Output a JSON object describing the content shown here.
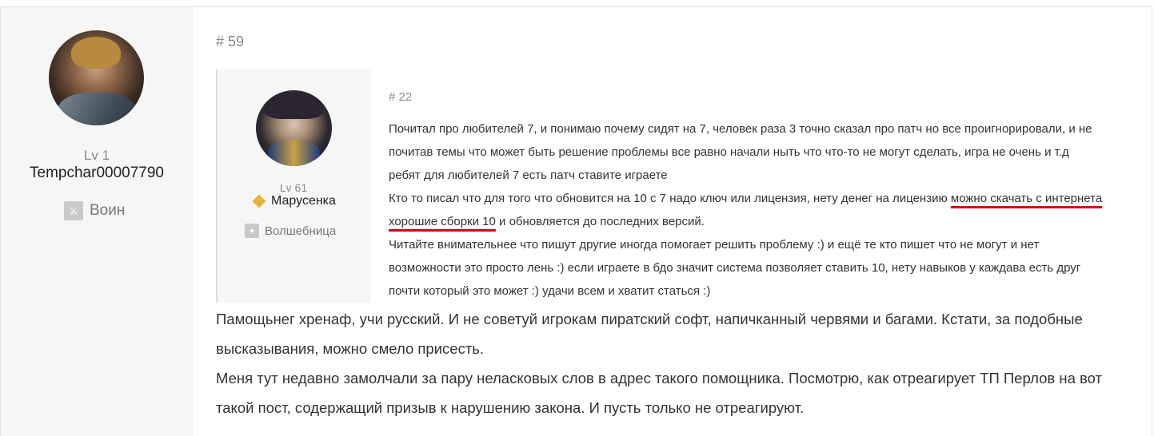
{
  "post": {
    "number": "# 59",
    "author": {
      "level": "Lv 1",
      "name": "Tempchar00007790",
      "class_name": "Воин",
      "class_icon": "warrior-class-icon"
    },
    "quote": {
      "number": "# 22",
      "author": {
        "level": "Lv 61",
        "name": "Марусенка",
        "badge_icon": "diamond-icon",
        "badge_color": "#e8b13a",
        "class_name": "Волшебница",
        "class_icon": "sorceress-class-icon"
      },
      "lines": {
        "p1_l1": "Почитал про любителей 7, и понимаю почему сидят на 7, человек раза 3 точно сказал про патч но все проигнорировали, и не",
        "p1_l2": "почитав темы что может быть решение проблемы все равно начали ныть что что-то не могут сделать, игра не очень и т.д",
        "p2": "ребят для любителей 7 есть патч ставите играете",
        "p3_start": "Кто то писал что для того что обновится на 10 с 7 надо ключ или лицензия, нету денег на лицензию ",
        "p3_underlined_a": "можно скачать с интернета",
        "p3_underlined_b": "хорошие сборки 10",
        "p3_end": " и обновляется до последних версий.",
        "p4_l1": "Читайте внимательнее что пишут другие иногда помогает решить проблему :) и ещё те кто пишет что не могут и нет",
        "p4_l2": "возможности это просто лень :) если играете в бдо значит система позволяет ставить 10, нету навыков у каждава есть друг",
        "p4_l3": "почти который это может :) удачи всем и хватит статься :)"
      },
      "highlight_color": "#d0021b"
    },
    "body": {
      "l1": "Памощьнег хренаф, учи русский. И не советуй игрокам пиратский софт, напичканный червями и багами. Кстати, за подобные",
      "l2": "высказывания, можно смело присесть.",
      "l3": "Меня тут недавно замолчали за пару неласковых слов в адрес такого помощника. Посмотрю, как отреагирует ТП Перлов на вот",
      "l4": "такой пост, содержащий призыв к нарушению закона. И пусть только не отреагируют."
    }
  }
}
